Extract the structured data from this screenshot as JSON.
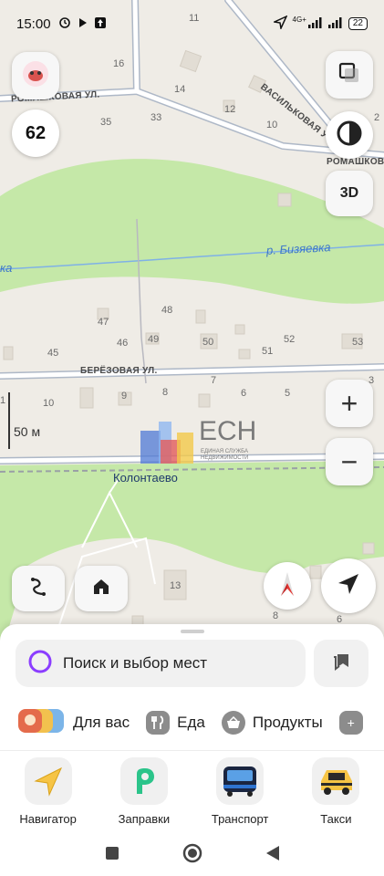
{
  "status_bar": {
    "time": "15:00",
    "network": "4G+",
    "battery": "22"
  },
  "map": {
    "streets": {
      "romashkovaya_left": "РОМАШКОВАЯ УЛ.",
      "romashkovaya_right": "РОМАШКОВ",
      "vasilkovaya": "ВАСИЛЬКОВАЯ У",
      "berezovaya": "БЕРЁЗОВАЯ УЛ."
    },
    "river_right": "р. Бизяевка",
    "river_left": "ка",
    "station": "Колонтаево",
    "houses": [
      "11",
      "16",
      "14",
      "12",
      "10",
      "2",
      "35",
      "33",
      "48",
      "47",
      "46",
      "49",
      "50",
      "51",
      "52",
      "53",
      "45",
      "10",
      "9",
      "8",
      "7",
      "6",
      "5",
      "3",
      "1",
      "13",
      "8",
      "6"
    ],
    "scale": "50 м",
    "watermark": {
      "title": "ЕСН",
      "line1": "ЕДИНАЯ СЛУЖБА",
      "line2": "НЕДВИЖИМОСТИ"
    }
  },
  "controls": {
    "speed_limit": "62",
    "mode_3d": "3D",
    "zoom_in": "+",
    "zoom_out": "−"
  },
  "sheet": {
    "search_placeholder": "Поиск и выбор мест",
    "chips": [
      {
        "label": "Для вас",
        "icon": "for-you-icon"
      },
      {
        "label": "Еда",
        "icon": "food-icon"
      },
      {
        "label": "Продукты",
        "icon": "groceries-icon"
      },
      {
        "label": "+",
        "icon": "more-icon"
      }
    ],
    "apps": [
      {
        "label": "Навигатор",
        "icon": "navigator-icon"
      },
      {
        "label": "Заправки",
        "icon": "fuel-icon"
      },
      {
        "label": "Транспорт",
        "icon": "transport-icon"
      },
      {
        "label": "Такси",
        "icon": "taxi-icon"
      }
    ]
  },
  "colors": {
    "map_bg": "#efece6",
    "park": "#c4e8a8",
    "road": "#ffffff",
    "road_outline": "#aeb8c7",
    "river": "#7fb1e6",
    "accent_search": "#8b3dff",
    "compass_red": "#e53935"
  }
}
